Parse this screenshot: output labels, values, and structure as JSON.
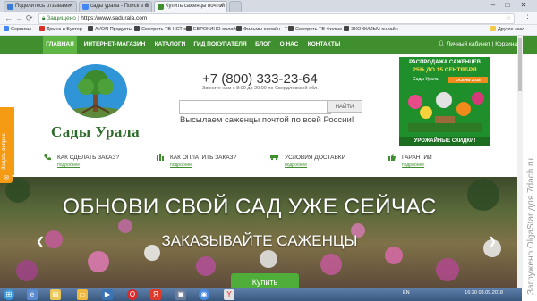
{
  "browser": {
    "tabs": [
      {
        "title": "Поделитесь отзывами",
        "color": "#3a7bd5"
      },
      {
        "title": "сады урала - Поиск в G",
        "color": "#4285f4"
      },
      {
        "title": "Купить саженцы почтой",
        "color": "#3f8f2e"
      }
    ],
    "window_min": "–",
    "window_max": "□",
    "window_close": "✕",
    "url": "https://www.sadurala.com",
    "secure_label": "Защищено",
    "bookmarks": [
      {
        "label": "Сервисы",
        "color": "#4285f4"
      },
      {
        "label": "Джинс и Бустер",
        "color": "#d93025"
      },
      {
        "label": "AVON Продукты",
        "color": "#444"
      },
      {
        "label": "Смотреть ТВ НСТ о",
        "color": "#444"
      },
      {
        "label": "ЕВРОКИНО онлайн",
        "color": "#444"
      },
      {
        "label": "Фильмы онлайн - Т",
        "color": "#444"
      },
      {
        "label": "Смотреть ТВ Фильм",
        "color": "#444"
      },
      {
        "label": "ЭКО ФИЛЬМ онлайн",
        "color": "#444"
      },
      {
        "label": "Другие закл",
        "color": "#f2c94c"
      }
    ]
  },
  "site": {
    "nav": [
      {
        "label": "ГЛАВНАЯ",
        "active": true
      },
      {
        "label": "ИНТЕРНЕТ-МАГАЗИН",
        "active": false
      },
      {
        "label": "КАТАЛОГИ",
        "active": false
      },
      {
        "label": "ГИД ПОКУПАТЕЛЯ",
        "active": false
      },
      {
        "label": "БЛОГ",
        "active": false
      },
      {
        "label": "О НАС",
        "active": false
      },
      {
        "label": "КОНТАКТЫ",
        "active": false
      }
    ],
    "cabinet": "Личный кабинет",
    "cart": "Корзина",
    "brand": "Сады Урала",
    "phone": "+7 (800) 333-23-64",
    "call_note": "Звоните нам с 8:00 до 20:00 по Свердловской обл.",
    "search_button": "НАЙТИ",
    "slogan": "Высылаем саженцы почтой по всей России!",
    "promo": {
      "line1": "РАСПРОДАЖА САЖЕНЦЕВ",
      "line2": "25% ДО 15 СЕНТЯБРЯ",
      "logo": "Сады Урала",
      "season": "ОСЕНЬ 2018",
      "bottom": "УРОЖАЙНЫЕ СКИДКИ!"
    },
    "info": [
      {
        "title": "КАК СДЕЛАТЬ ЗАКАЗ?",
        "sub": "подробнее",
        "icon": "phone-icon"
      },
      {
        "title": "КАК ОПЛАТИТЬ ЗАКАЗ?",
        "sub": "подробнее",
        "icon": "payment-icon"
      },
      {
        "title": "УСЛОВИЯ ДОСТАВКИ",
        "sub": "подробнее",
        "icon": "truck-icon"
      },
      {
        "title": "ГАРАНТИИ",
        "sub": "подробнее",
        "icon": "thumbs-up-icon"
      }
    ],
    "banner": {
      "headline": "ОБНОВИ СВОЙ САД УЖЕ СЕЙЧАС",
      "subline": "ЗАКАЗЫВАЙТЕ САЖЕНЦЫ",
      "button": "Купить"
    },
    "feedback": "Задать вопрос"
  },
  "watermark": "Загружено OlgaStar для 7dach.ru",
  "taskbar": {
    "lang": "EN",
    "time": "16:30",
    "date": "03.09.2018"
  }
}
